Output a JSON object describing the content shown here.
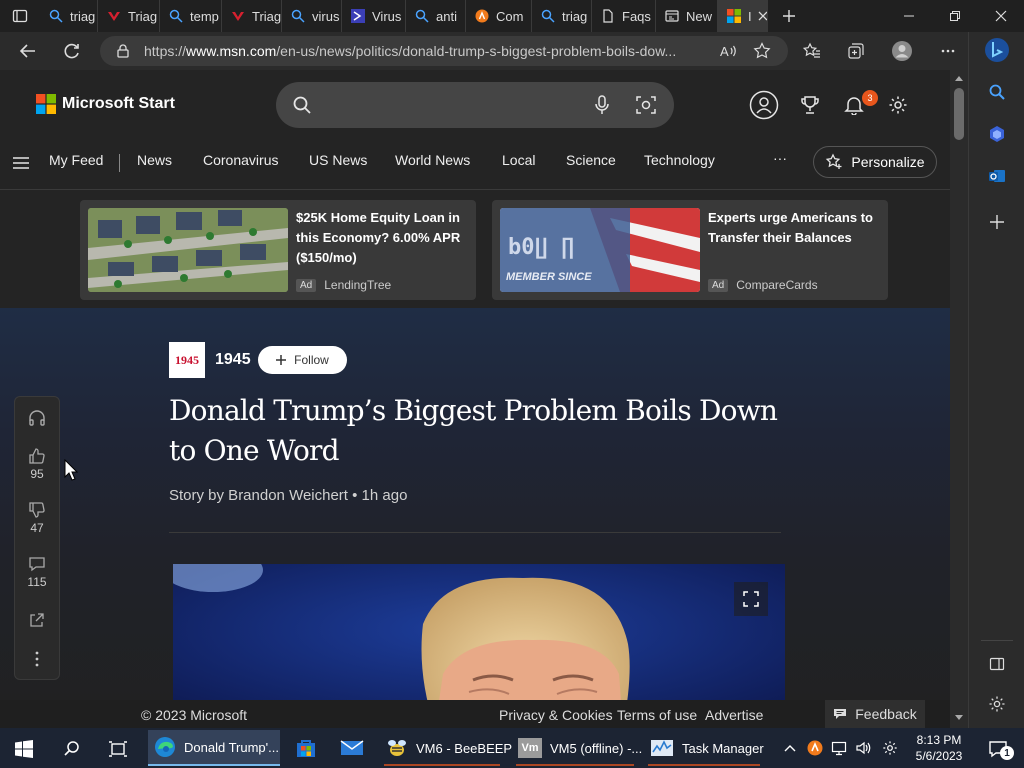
{
  "browser": {
    "tabs": [
      {
        "label": "triag",
        "icon": "search-icon"
      },
      {
        "label": "Triag",
        "icon": "tria-icon"
      },
      {
        "label": "temp",
        "icon": "search-icon"
      },
      {
        "label": "Triag",
        "icon": "tria-icon"
      },
      {
        "label": "virus",
        "icon": "search-icon"
      },
      {
        "label": "Virus",
        "icon": "virustotal-icon"
      },
      {
        "label": "anti",
        "icon": "search-icon"
      },
      {
        "label": "Com",
        "icon": "avast-icon"
      },
      {
        "label": "triag",
        "icon": "search-icon"
      },
      {
        "label": "Faqs",
        "icon": "document-icon"
      },
      {
        "label": "New",
        "icon": "newtab-icon"
      },
      {
        "label": "I",
        "icon": "msn-icon",
        "active": true
      }
    ],
    "url": {
      "prefix": "https://",
      "host": "www.msn.com",
      "path": "/en-us/news/politics/donald-trump-s-biggest-problem-boils-dow..."
    }
  },
  "msn": {
    "brand": "Microsoft Start",
    "notification_count": "3",
    "nav": [
      "My Feed",
      "News",
      "Coronavirus",
      "US News",
      "World News",
      "Local",
      "Science",
      "Technology"
    ],
    "more": "···",
    "personalize": "Personalize"
  },
  "ads": [
    {
      "title": "$25K Home Equity Loan in this Economy? 6.00% APR ($150/mo)",
      "badge": "Ad",
      "source": "LendingTree"
    },
    {
      "title": "Experts urge Americans to Transfer their Balances",
      "badge": "Ad",
      "source": "CompareCards",
      "image_text": "MEMBER SINCE"
    }
  ],
  "article": {
    "publisher_logo": "1945",
    "publisher": "1945",
    "follow": "Follow",
    "headline": "Donald Trump’s Biggest Problem Boils Down to One Word",
    "byline": "Story by Brandon Weichert • 1h ago"
  },
  "reactions": {
    "likes": "95",
    "dislikes": "47",
    "comments": "115"
  },
  "footer": {
    "copyright": "© 2023 Microsoft",
    "privacy": "Privacy & Cookies",
    "terms": "Terms of use",
    "advertise": "Advertise",
    "feedback": "Feedback"
  },
  "taskbar": {
    "apps": [
      {
        "label": "Donald Trump'...",
        "icon": "edge-icon",
        "active": true
      },
      {
        "label": "",
        "icon": "store-icon"
      },
      {
        "label": "",
        "icon": "mail-icon"
      },
      {
        "label": "VM6 - BeeBEEP",
        "icon": "beebeep-icon"
      },
      {
        "label": "VM5 (offline) -...",
        "icon": "vm-icon",
        "icon_text": "Vm"
      },
      {
        "label": "Task Manager",
        "icon": "taskmanager-icon"
      }
    ],
    "time": "8:13 PM",
    "date": "5/6/2023",
    "notification_badge": "1"
  },
  "colors": {
    "accent": "#76b9ed",
    "badge": "#e8561c",
    "publisher_red": "#c8102e"
  }
}
